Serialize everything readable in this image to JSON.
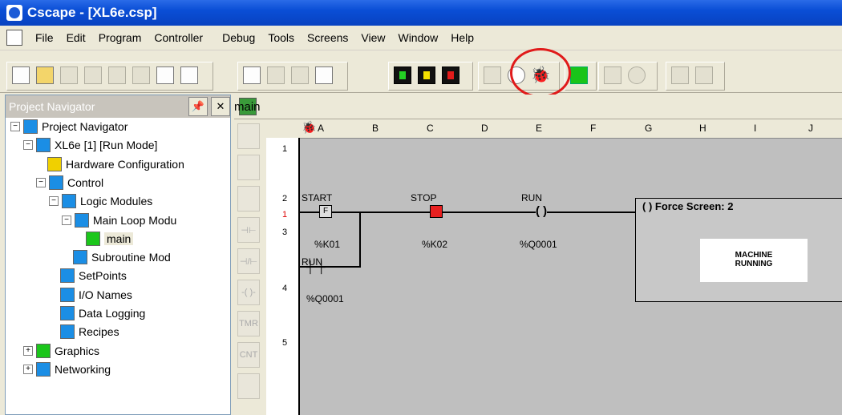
{
  "app": {
    "title": "Cscape - [XL6e.csp]"
  },
  "menu": [
    "File",
    "Edit",
    "Program",
    "Controller",
    "Debug",
    "Tools",
    "Screens",
    "View",
    "Window",
    "Help"
  ],
  "navigator": {
    "header": "Project Navigator",
    "items": [
      {
        "label": "Project Navigator",
        "level": 0,
        "expander": "−",
        "icon": "cyan"
      },
      {
        "label": "XL6e [1] [Run Mode]",
        "level": 1,
        "expander": "−",
        "icon": "cyan"
      },
      {
        "label": "Hardware Configuration",
        "level": 2,
        "expander": "",
        "icon": "yellow"
      },
      {
        "label": "Control",
        "level": 2,
        "expander": "−",
        "icon": "cyan"
      },
      {
        "label": "Logic Modules",
        "level": 3,
        "expander": "−",
        "icon": "cyan"
      },
      {
        "label": "Main Loop Modu",
        "level": 4,
        "expander": "−",
        "icon": "cyan"
      },
      {
        "label": "main",
        "level": 5,
        "expander": "",
        "icon": "green",
        "selected": true
      },
      {
        "label": "Subroutine Mod",
        "level": 4,
        "expander": "",
        "icon": "cyan"
      },
      {
        "label": "SetPoints",
        "level": 3,
        "expander": "",
        "icon": "cyan"
      },
      {
        "label": "I/O Names",
        "level": 3,
        "expander": "",
        "icon": "cyan"
      },
      {
        "label": "Data Logging",
        "level": 3,
        "expander": "",
        "icon": "cyan"
      },
      {
        "label": "Recipes",
        "level": 3,
        "expander": "",
        "icon": "cyan"
      },
      {
        "label": "Graphics",
        "level": 1,
        "expander": "+",
        "icon": "green"
      },
      {
        "label": "Networking",
        "level": 1,
        "expander": "+",
        "icon": "cyan"
      }
    ]
  },
  "editor": {
    "tab": "main",
    "columns": [
      "A",
      "B",
      "C",
      "D",
      "E",
      "F",
      "G",
      "H",
      "I",
      "J"
    ],
    "rows": [
      "1",
      "2",
      "1",
      "3",
      "4",
      "5"
    ],
    "palette": [
      "",
      "",
      "",
      "⊣⊢",
      "⊣/⊢",
      "-( )-",
      "TMR",
      "CNT",
      ""
    ],
    "rung": {
      "start_label": "START",
      "start_addr": "%K01",
      "start_mark": "F",
      "stop_label": "STOP",
      "stop_addr": "%K02",
      "run_label": "RUN",
      "run_addr": "%Q0001",
      "coil_symbol": "( )",
      "seal_label": "RUN",
      "seal_addr": "%Q0001",
      "force_label": "( ) Force Screen: 2",
      "machine_text_1": "MACHINE",
      "machine_text_2": "RUNNING"
    }
  }
}
